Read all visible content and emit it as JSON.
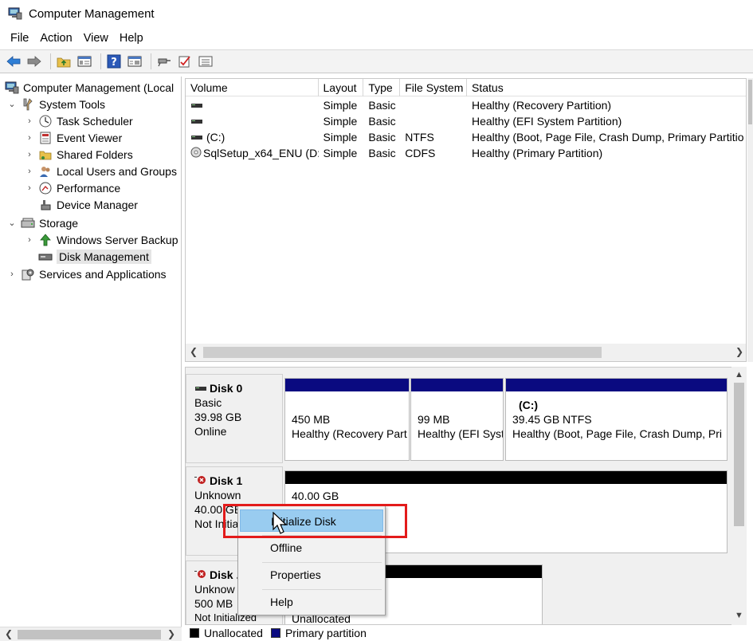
{
  "window": {
    "title": "Computer Management"
  },
  "menu": [
    "File",
    "Action",
    "View",
    "Help"
  ],
  "toolbar_icons": [
    "back-arrow-icon",
    "forward-arrow-icon",
    "up-folder-icon",
    "show-hide-tree-icon",
    "help-icon",
    "properties-icon",
    "connect-icon",
    "check-icon",
    "list-icon"
  ],
  "tree": {
    "root": "Computer Management (Local",
    "system_tools": "System Tools",
    "task_scheduler": "Task Scheduler",
    "event_viewer": "Event Viewer",
    "shared_folders": "Shared Folders",
    "local_users": "Local Users and Groups",
    "performance": "Performance",
    "device_manager": "Device Manager",
    "storage": "Storage",
    "windows_backup": "Windows Server Backup",
    "disk_management": "Disk Management",
    "services_apps": "Services and Applications"
  },
  "volumes": {
    "headers": [
      "Volume",
      "Layout",
      "Type",
      "File System",
      "Status"
    ],
    "rows": [
      {
        "volume": "",
        "layout": "Simple",
        "type": "Basic",
        "fs": "",
        "status": "Healthy (Recovery Partition)"
      },
      {
        "volume": "",
        "layout": "Simple",
        "type": "Basic",
        "fs": "",
        "status": "Healthy (EFI System Partition)"
      },
      {
        "volume": "(C:)",
        "layout": "Simple",
        "type": "Basic",
        "fs": "NTFS",
        "status": "Healthy (Boot, Page File, Crash Dump, Primary Partitio"
      },
      {
        "volume": "SqlSetup_x64_ENU (D:)",
        "layout": "Simple",
        "type": "Basic",
        "fs": "CDFS",
        "status": "Healthy (Primary Partition)"
      }
    ]
  },
  "disks": {
    "disk0": {
      "name": "Disk 0",
      "type": "Basic",
      "size": "39.98 GB",
      "state": "Online",
      "partitions": [
        {
          "title": "",
          "size": "450 MB",
          "status": "Healthy (Recovery Part"
        },
        {
          "title": "",
          "size": "99 MB",
          "status": "Healthy (EFI Syst"
        },
        {
          "title": "(C:)",
          "size": "39.45 GB NTFS",
          "status": "Healthy (Boot, Page File, Crash Dump, Pri"
        }
      ]
    },
    "disk1": {
      "name": "Disk 1",
      "type": "Unknown",
      "size": "40.00 GB",
      "state": "Not Initia",
      "partition_size": "40.00 GB"
    },
    "disk2": {
      "name": "Disk .",
      "type": "Unknow",
      "size": "500 MB",
      "state": "Not Initialized",
      "partition_label": "Unallocated"
    }
  },
  "legend": {
    "unallocated": "Unallocated",
    "primary": "Primary partition"
  },
  "context_menu": {
    "items": [
      "Initialize Disk",
      "Offline",
      "Properties",
      "Help"
    ]
  },
  "colors": {
    "primary_partition_bar": "#0a0a80",
    "unallocated_bar": "#000000",
    "menu_highlight": "#99ccf0",
    "annotation_box": "#e31b1b"
  }
}
